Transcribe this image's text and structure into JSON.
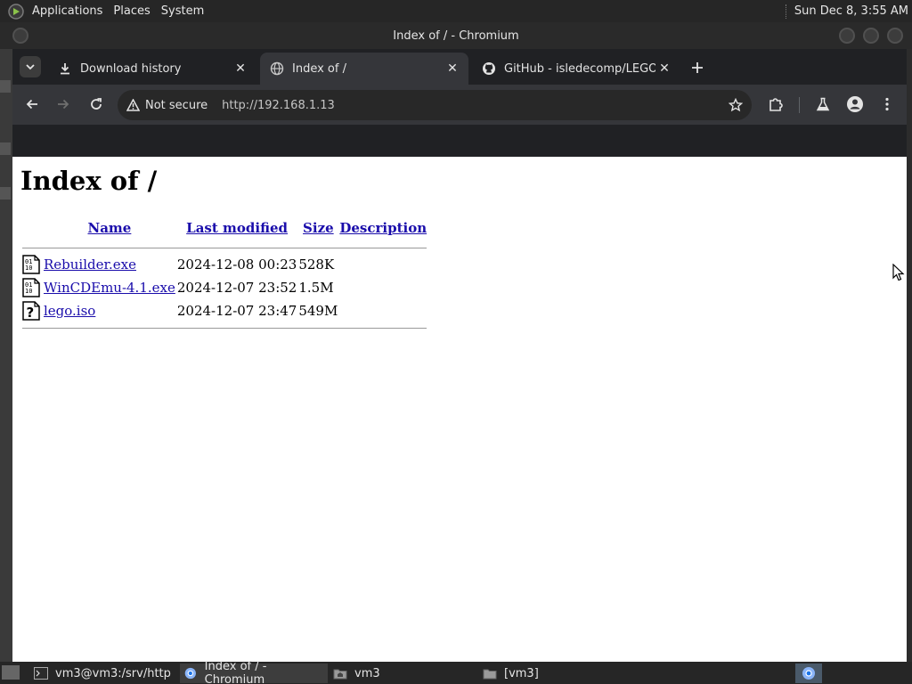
{
  "top_panel": {
    "menus": [
      "Applications",
      "Places",
      "System"
    ],
    "clock": "Sun Dec  8,  3:55 AM"
  },
  "window": {
    "title": "Index of / - Chromium"
  },
  "tabs": [
    {
      "title": "Download history",
      "icon": "download-icon",
      "active": false
    },
    {
      "title": "Index of /",
      "icon": "globe-icon",
      "active": true
    },
    {
      "title": "GitHub - isledecomp/LEGOIs",
      "icon": "github-icon",
      "active": false
    }
  ],
  "toolbar": {
    "security_label": "Not secure",
    "url": "http://192.168.1.13"
  },
  "page": {
    "heading": "Index of /",
    "columns": [
      "Name",
      "Last modified",
      "Size",
      "Description"
    ],
    "rows": [
      {
        "name": "Rebuilder.exe",
        "modified": "2024-12-08 00:23",
        "size": "528K",
        "description": "",
        "icon": "binary-file-icon"
      },
      {
        "name": "WinCDEmu-4.1.exe",
        "modified": "2024-12-07 23:52",
        "size": "1.5M",
        "description": "",
        "icon": "binary-file-icon"
      },
      {
        "name": "lego.iso",
        "modified": "2024-12-07 23:47",
        "size": "549M",
        "description": "",
        "icon": "unknown-file-icon"
      }
    ]
  },
  "taskbar": {
    "items": [
      {
        "label": "vm3@vm3:/srv/http",
        "icon": "terminal-icon",
        "active": false
      },
      {
        "label": "Index of / - Chromium",
        "icon": "chromium-icon",
        "active": true
      },
      {
        "label": "vm3",
        "icon": "folder-home-icon",
        "active": false
      },
      {
        "label": "[vm3]",
        "icon": "folder-icon",
        "active": false
      }
    ]
  },
  "colors": {
    "panel": "#262626",
    "chrome_frame": "#202124",
    "toolbar": "#35363a",
    "link": "#1a0dab"
  }
}
